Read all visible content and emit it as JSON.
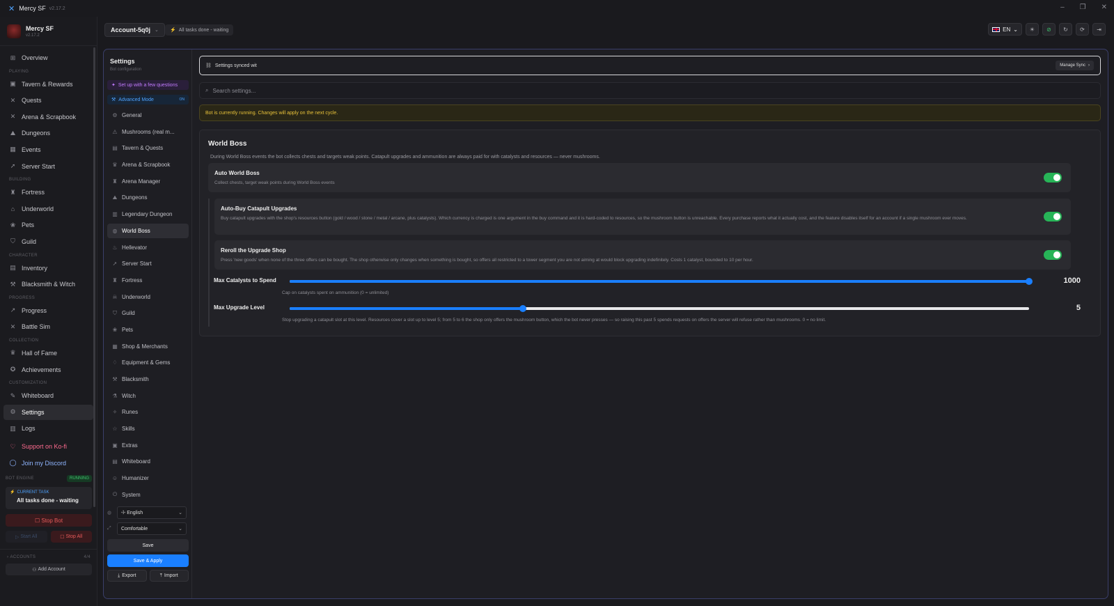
{
  "window": {
    "title": "Mercy SF",
    "version": "v2.17.2"
  },
  "profile": {
    "name": "Mercy SF",
    "version": "v2.17.2"
  },
  "sidebar": {
    "overview": "Overview",
    "sections": {
      "playing": "PLAYING",
      "building": "BUILDING",
      "character": "CHARACTER",
      "progress": "PROGRESS",
      "collection": "COLLECTION",
      "customization": "CUSTOMIZATION"
    },
    "playing": [
      "Tavern & Rewards",
      "Quests",
      "Arena & Scrapbook",
      "Dungeons",
      "Events",
      "Server Start"
    ],
    "building": [
      "Fortress",
      "Underworld",
      "Pets",
      "Guild"
    ],
    "character": [
      "Inventory",
      "Blacksmith & Witch"
    ],
    "progress": [
      "Progress",
      "Battle Sim"
    ],
    "collection": [
      "Hall of Fame",
      "Achievements"
    ],
    "customization": [
      "Whiteboard",
      "Settings",
      "Logs"
    ],
    "kofi": "Support on Ko-fi",
    "discord": "Join my Discord"
  },
  "engine": {
    "label": "BOT ENGINE",
    "status": "RUNNING",
    "current_task_label": "CURRENT TASK",
    "current_task": "All tasks done - waiting",
    "stop_bot": "Stop Bot",
    "start_all": "Start All",
    "stop_all": "Stop All",
    "accounts_label": "ACCOUNTS",
    "accounts_count": "4/4",
    "add_account": "Add Account"
  },
  "header": {
    "account": "Account-5q0j",
    "task_status": "All tasks done - waiting",
    "lang": "EN"
  },
  "settings_nav": {
    "title": "Settings",
    "subtitle": "Bot configuration",
    "setup": "Set up with a few questions",
    "advanced": "Advanced Mode",
    "advanced_state": "ON",
    "items": [
      "General",
      "Mushrooms (real m...",
      "Tavern & Quests",
      "Arena & Scrapbook",
      "Arena Manager",
      "Dungeons",
      "Legendary Dungeon",
      "World Boss",
      "Hellevator",
      "Server Start",
      "Fortress",
      "Underworld",
      "Guild",
      "Pets",
      "Shop & Merchants",
      "Equipment & Gems",
      "Blacksmith",
      "Witch",
      "Runes",
      "Skills",
      "Extras",
      "Whiteboard",
      "Humanizer",
      "System"
    ],
    "language": "English",
    "density": "Comfortable",
    "save": "Save",
    "save_apply": "Save & Apply",
    "export": "Export",
    "import": "Import"
  },
  "content": {
    "sync_text": "Settings synced wit",
    "manage_sync": "Manage Sync",
    "search_placeholder": "Search settings...",
    "warning": "Bot is currently running. Changes will apply on the next cycle.",
    "section_title": "World Boss",
    "section_desc": "During World Boss events the bot collects chests and targets weak points. Catapult upgrades and ammunition are always paid for with catalysts and resources — never mushrooms.",
    "options": [
      {
        "title": "Auto World Boss",
        "desc": "Collect chests, target weak points during World Boss events",
        "enabled": true
      },
      {
        "title": "Auto-Buy Catapult Upgrades",
        "desc": "Buy catapult upgrades with the shop's resources button (gold / wood / stone / metal / arcane, plus catalysts). Which currency is charged is one argument in the buy command and it is hard-coded to resources, so the mushroom button is unreachable. Every purchase reports what it actually cost, and the feature disables itself for an account if a single mushroom ever moves.",
        "enabled": true
      },
      {
        "title": "Reroll the Upgrade Shop",
        "desc": "Press 'new goods' when none of the three offers can be bought. The shop otherwise only changes when something is bought, so offers all restricted to a tower segment you are not aiming at would block upgrading indefinitely. Costs 1 catalyst, bounded to 10 per hour.",
        "enabled": true
      }
    ],
    "sliders": [
      {
        "label": "Max Catalysts to Spend",
        "value": "1000",
        "fraction": 1.0,
        "desc": "Cap on catalysts spent on ammunition (0 = unlimited)"
      },
      {
        "label": "Max Upgrade Level",
        "value": "5",
        "fraction": 0.315,
        "desc": "Stop upgrading a catapult slot at this level. Resources cover a slot up to level 5; from 5 to 6 the shop only offers the mushroom button, which the bot never presses — so raising this past 5 spends requests on offers the server will refuse rather than mushrooms. 0 = no limit."
      }
    ]
  },
  "colors": {
    "accent": "#1a7fff",
    "toggle_on": "#27b457",
    "warning": "#e8c23a",
    "danger": "#e85a5a",
    "setup": "#c27bff"
  }
}
